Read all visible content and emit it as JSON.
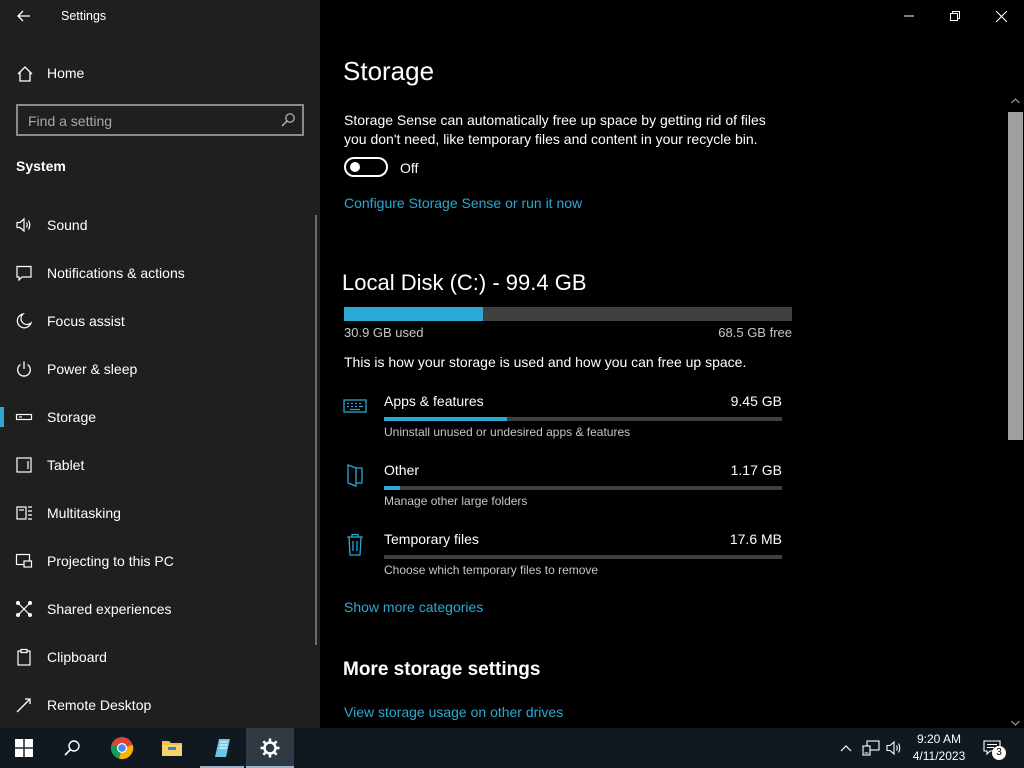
{
  "window": {
    "title": "Settings"
  },
  "sidebar": {
    "home_label": "Home",
    "search_placeholder": "Find a setting",
    "section": "System",
    "items": [
      {
        "label": "Sound",
        "icon": "speaker-icon"
      },
      {
        "label": "Notifications & actions",
        "icon": "notification-icon"
      },
      {
        "label": "Focus assist",
        "icon": "moon-icon"
      },
      {
        "label": "Power & sleep",
        "icon": "power-icon"
      },
      {
        "label": "Storage",
        "icon": "drive-icon",
        "selected": true
      },
      {
        "label": "Tablet",
        "icon": "tablet-icon"
      },
      {
        "label": "Multitasking",
        "icon": "multitasking-icon"
      },
      {
        "label": "Projecting to this PC",
        "icon": "projecting-icon"
      },
      {
        "label": "Shared experiences",
        "icon": "shared-icon"
      },
      {
        "label": "Clipboard",
        "icon": "clipboard-icon"
      },
      {
        "label": "Remote Desktop",
        "icon": "remote-desktop-icon"
      }
    ]
  },
  "main": {
    "title": "Storage",
    "sense_description": "Storage Sense can automatically free up space by getting rid of files you don't need, like temporary files and content in your recycle bin.",
    "toggle_state": "Off",
    "configure_link": "Configure Storage Sense or run it now",
    "disk": {
      "title": "Local Disk (C:) - 99.4 GB",
      "used_label": "30.9 GB used",
      "free_label": "68.5 GB free",
      "used_fraction": 0.311
    },
    "usage_description": "This is how your storage is used and how you can free up space.",
    "categories": [
      {
        "name": "Apps & features",
        "size": "9.45 GB",
        "description": "Uninstall unused or undesired apps & features",
        "fraction": 0.31,
        "icon": "keyboard-icon"
      },
      {
        "name": "Other",
        "size": "1.17 GB",
        "description": "Manage other large folders",
        "fraction": 0.04,
        "icon": "folder-icon"
      },
      {
        "name": "Temporary files",
        "size": "17.6 MB",
        "description": "Choose which temporary files to remove",
        "fraction": 0.0,
        "icon": "trash-icon"
      }
    ],
    "show_more_link": "Show more categories",
    "more_title": "More storage settings",
    "other_drives_link": "View storage usage on other drives"
  },
  "taskbar": {
    "time": "9:20 AM",
    "date": "4/11/2023",
    "notification_count": "3"
  },
  "colors": {
    "accent": "#29a9d3",
    "sidebar_bg": "#1f1f1f",
    "main_bg": "#000000"
  }
}
